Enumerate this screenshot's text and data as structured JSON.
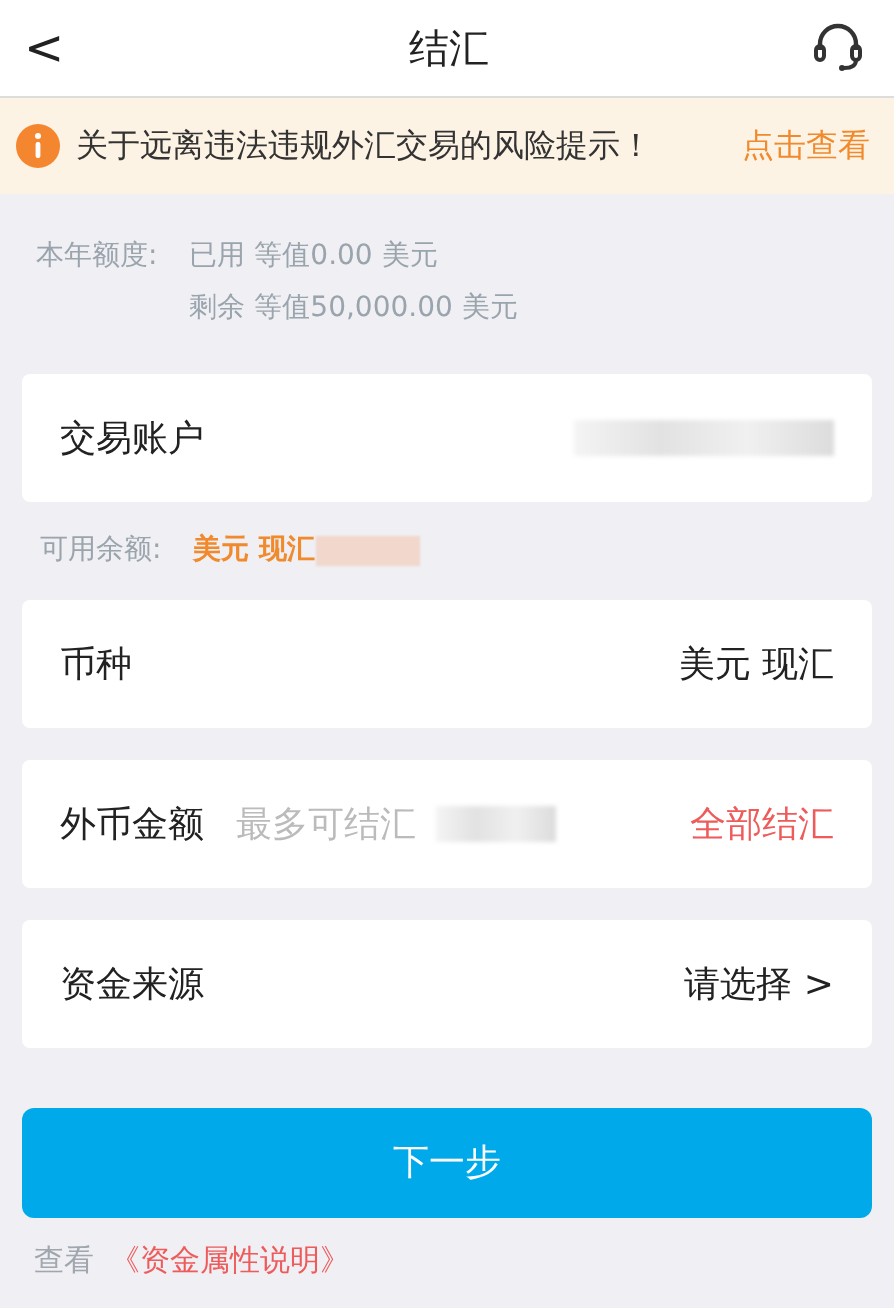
{
  "header": {
    "back": "<",
    "title": "结汇"
  },
  "notice": {
    "text": "关于远离违法违规外汇交易的风险提示！",
    "link": "点击查看"
  },
  "quota": {
    "label": "本年额度:",
    "lines": [
      "已用 等值0.00 美元",
      "剩余 等值50,000.00 美元"
    ]
  },
  "account": {
    "label": "交易账户",
    "redacted": true
  },
  "balance": {
    "label": "可用余额:",
    "value": "美元 现汇",
    "redacted": true
  },
  "currency": {
    "label": "币种",
    "value": "美元 现汇"
  },
  "amount": {
    "label": "外币金额",
    "placeholder": "最多可结汇",
    "redacted": true,
    "action": "全部结汇"
  },
  "source": {
    "label": "资金来源",
    "value": "请选择",
    "chevron": ">"
  },
  "next_button": "下一步",
  "footer": {
    "prefix": "查看",
    "link": "《资金属性说明》"
  }
}
